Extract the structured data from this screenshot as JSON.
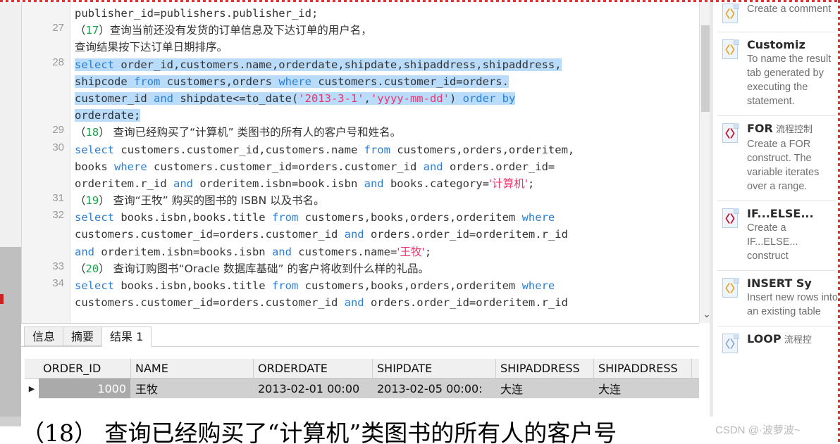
{
  "window": {
    "title": "PL/SQL Developer - SQL Window"
  },
  "editor": {
    "gutter_numbers": [
      "27",
      "28",
      "29",
      "30",
      "31",
      "32",
      "33",
      "34"
    ],
    "lines": [
      {
        "num": "",
        "segments": [
          {
            "t": "publisher_id=publishers.publisher_id;",
            "c": "plain"
          }
        ]
      },
      {
        "num": "27",
        "segments": [
          {
            "t": "（",
            "c": "cn"
          },
          {
            "t": "17",
            "c": "num"
          },
          {
            "t": "）查询当前还没有发货的订单信息及下达订单的用户名，",
            "c": "cn"
          }
        ]
      },
      {
        "num": "",
        "segments": [
          {
            "t": "查询结果按下达订单日期排序。",
            "c": "cn"
          }
        ]
      },
      {
        "num": "28",
        "segments": [
          {
            "t": "select",
            "c": "kw-sel"
          },
          {
            "t": " order_id,customers.name,orderdate,shipdate,shipaddress,shipaddress,",
            "c": "sel"
          }
        ]
      },
      {
        "num": "",
        "segments": [
          {
            "t": "shipcode ",
            "c": "sel"
          },
          {
            "t": "from",
            "c": "kw-sel"
          },
          {
            "t": " customers,orders ",
            "c": "sel"
          },
          {
            "t": "where",
            "c": "kw-sel"
          },
          {
            "t": " customers.customer_id=orders.",
            "c": "sel"
          }
        ]
      },
      {
        "num": "",
        "segments": [
          {
            "t": "customer_id ",
            "c": "sel"
          },
          {
            "t": "and",
            "c": "kw-sel"
          },
          {
            "t": " shipdate<=to_date(",
            "c": "sel"
          },
          {
            "t": "'2013-3-1'",
            "c": "str-sel"
          },
          {
            "t": ",",
            "c": "sel"
          },
          {
            "t": "'yyyy-mm-dd'",
            "c": "str-sel"
          },
          {
            "t": ") ",
            "c": "sel"
          },
          {
            "t": "order by",
            "c": "kw-sel"
          }
        ]
      },
      {
        "num": "",
        "segments": [
          {
            "t": "orderdate;",
            "c": "sel"
          }
        ]
      },
      {
        "num": "29",
        "segments": [
          {
            "t": "（",
            "c": "cn"
          },
          {
            "t": "18",
            "c": "num"
          },
          {
            "t": "） 查询已经购买了“计算机” 类图书的所有人的客户号和姓名。",
            "c": "cn"
          }
        ]
      },
      {
        "num": "30",
        "segments": [
          {
            "t": "select",
            "c": "kw"
          },
          {
            "t": " customers.customer_id,customers.name ",
            "c": "plain"
          },
          {
            "t": "from",
            "c": "kw"
          },
          {
            "t": " customers,orders,orderitem,",
            "c": "plain"
          }
        ]
      },
      {
        "num": "",
        "segments": [
          {
            "t": "books ",
            "c": "plain"
          },
          {
            "t": "where",
            "c": "kw"
          },
          {
            "t": " customers.customer_id=orders.customer_id ",
            "c": "plain"
          },
          {
            "t": "and",
            "c": "kw"
          },
          {
            "t": " orders.order_id=",
            "c": "plain"
          }
        ]
      },
      {
        "num": "",
        "segments": [
          {
            "t": "orderitem.r_id ",
            "c": "plain"
          },
          {
            "t": "and",
            "c": "kw"
          },
          {
            "t": " orderitem.isbn=book.isbn ",
            "c": "plain"
          },
          {
            "t": "and",
            "c": "kw"
          },
          {
            "t": " books.category=",
            "c": "plain"
          },
          {
            "t": "'计算机'",
            "c": "str"
          },
          {
            "t": ";",
            "c": "plain"
          }
        ]
      },
      {
        "num": "31",
        "segments": [
          {
            "t": "（",
            "c": "cn"
          },
          {
            "t": "19",
            "c": "num"
          },
          {
            "t": "） 查询“王牧” 购买的图书的 ISBN 以及书名。",
            "c": "cn"
          }
        ]
      },
      {
        "num": "32",
        "segments": [
          {
            "t": "select",
            "c": "kw"
          },
          {
            "t": " books.isbn,books.title ",
            "c": "plain"
          },
          {
            "t": "from",
            "c": "kw"
          },
          {
            "t": " customers,books,orders,orderitem ",
            "c": "plain"
          },
          {
            "t": "where",
            "c": "kw"
          }
        ]
      },
      {
        "num": "",
        "segments": [
          {
            "t": "customers.customer_id=orders.customer_id ",
            "c": "plain"
          },
          {
            "t": "and",
            "c": "kw"
          },
          {
            "t": " orders.order_id=orderitem.r_id",
            "c": "plain"
          }
        ]
      },
      {
        "num": "",
        "segments": [
          {
            "t": "and",
            "c": "kw"
          },
          {
            "t": " orderitem.isbn=books.isbn ",
            "c": "plain"
          },
          {
            "t": "and",
            "c": "kw"
          },
          {
            "t": " customers.name=",
            "c": "plain"
          },
          {
            "t": "'王牧'",
            "c": "str"
          },
          {
            "t": ";",
            "c": "plain"
          }
        ]
      },
      {
        "num": "33",
        "segments": [
          {
            "t": "（",
            "c": "cn"
          },
          {
            "t": "20",
            "c": "num"
          },
          {
            "t": "） 查询订购图书“Oracle 数据库基础” 的客户将收到什么样的礼品。",
            "c": "cn"
          }
        ]
      },
      {
        "num": "34",
        "segments": [
          {
            "t": "select",
            "c": "kw"
          },
          {
            "t": " books.isbn,books.title ",
            "c": "plain"
          },
          {
            "t": "from",
            "c": "kw"
          },
          {
            "t": " customers,books,orders,orderitem ",
            "c": "plain"
          },
          {
            "t": "where",
            "c": "kw"
          }
        ]
      },
      {
        "num": "",
        "segments": [
          {
            "t": "customers.customer_id=orders.customer_id ",
            "c": "plain"
          },
          {
            "t": "and",
            "c": "kw"
          },
          {
            "t": " orders.order_id=orderitem.r_id",
            "c": "plain"
          }
        ]
      }
    ],
    "scrollbar": {
      "down_arrow": "⌄"
    }
  },
  "results": {
    "tabs": [
      {
        "label": "信息",
        "active": false
      },
      {
        "label": "摘要",
        "active": false
      },
      {
        "label": "结果 1",
        "active": true
      }
    ],
    "columns": [
      "ORDER_ID",
      "NAME",
      "ORDERDATE",
      "SHIPDATE",
      "SHIPADDRESS",
      "SHIPADDRESS"
    ],
    "rows": [
      {
        "marker": "▶",
        "cells": [
          "1000",
          "王牧",
          "2013-02-01 00:00",
          "2013-02-05 00:00:",
          "大连",
          "大连"
        ]
      }
    ]
  },
  "sidebar": {
    "items": [
      {
        "title": "",
        "title_zh": "",
        "desc": "Create a comment",
        "icon": "code-snippet-icon",
        "glyph": "〈〉",
        "glyph_color": "#e8a317",
        "partial_top": true
      },
      {
        "title": "Customiz",
        "title_zh": "",
        "desc": "To name the result tab generated by executing the statement.",
        "icon": "code-snippet-icon",
        "glyph": "〈〉",
        "glyph_color": "#e8a317"
      },
      {
        "title": "FOR",
        "title_zh": "流程控制",
        "desc": "Create a FOR construct. The variable iterates over a range.",
        "icon": "code-snippet-icon",
        "glyph": "〈〉",
        "glyph_color": "#d0021b"
      },
      {
        "title": "IF...ELSE...",
        "title_zh": "",
        "desc": "Create a IF...ELSE... construct",
        "icon": "code-snippet-icon",
        "glyph": "〈〉",
        "glyph_color": "#d0021b"
      },
      {
        "title": "INSERT Sy",
        "title_zh": "",
        "desc": "Insert new rows into an existing table",
        "icon": "code-snippet-icon",
        "glyph": "〈〉",
        "glyph_color": "#e8a317"
      },
      {
        "title": "LOOP",
        "title_zh": "流程控",
        "desc": "",
        "icon": "code-snippet-icon",
        "glyph": "〈〉",
        "glyph_color": "#8aa9c8"
      }
    ]
  },
  "overlay": {
    "text": "（18） 查询已经购买了“计算机”类图书的所有人的客户号"
  },
  "watermark": {
    "text": "CSDN @·波萝波~"
  },
  "colors": {
    "keyword": "#2a7fd4",
    "string": "#f0336b",
    "number": "#16a34a",
    "selection": "#b9dcfb",
    "gutter_bg": "#f4f4f4",
    "accent_red": "#e03030"
  }
}
